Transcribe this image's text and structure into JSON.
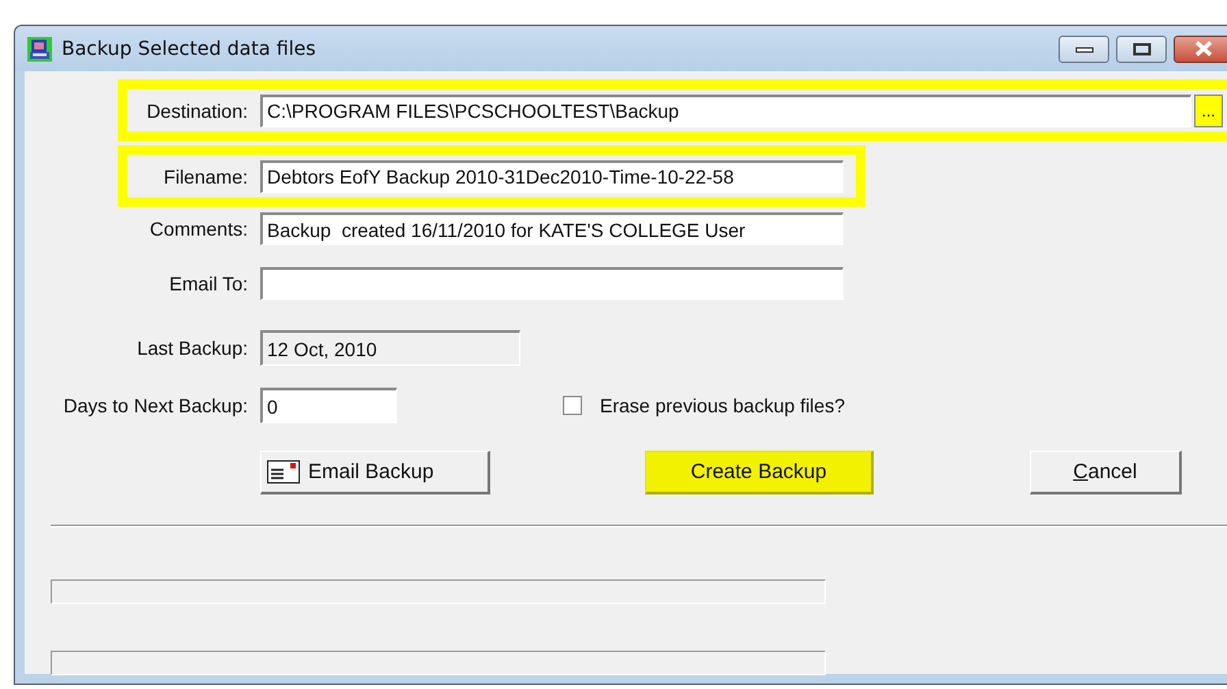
{
  "window": {
    "title": "Backup Selected data files"
  },
  "fields": [
    {
      "label": "Destination:",
      "value": "C:\\PROGRAM FILES\\PCSCHOOLTEST\\Backup",
      "kind": "path",
      "highlighted": true,
      "disabled": false,
      "browse": "..."
    },
    {
      "label": "Filename:",
      "value": "Debtors EofY Backup 2010-31Dec2010-Time-10-22-58",
      "kind": "text",
      "highlighted": true,
      "disabled": false
    },
    {
      "label": "Comments:",
      "value": "Backup  created 16/11/2010 for KATE'S COLLEGE User",
      "kind": "text",
      "highlighted": false,
      "disabled": false
    },
    {
      "label": "Email To:",
      "kind": "text",
      "highlighted": false,
      "disabled": false
    },
    {
      "label": "Last Backup:",
      "value": "12 Oct, 2010",
      "kind": "date",
      "highlighted": false,
      "disabled": true
    },
    {
      "label": "Days to Next Backup:",
      "value": "0",
      "kind": "number",
      "highlighted": false,
      "disabled": false
    }
  ],
  "checkbox": {
    "label": "Erase previous backup files?",
    "checked": false
  },
  "buttons": [
    {
      "label": "Email Backup",
      "kind": "email",
      "highlighted": false,
      "underline_first": false
    },
    {
      "label": "Create Backup",
      "kind": "create",
      "highlighted": true,
      "underline_first": false
    },
    {
      "label": "Cancel",
      "kind": "cancel",
      "highlighted": false,
      "underline_first": true
    }
  ],
  "progress": [
    {
      "level": 0
    },
    {
      "level": 0
    }
  ]
}
